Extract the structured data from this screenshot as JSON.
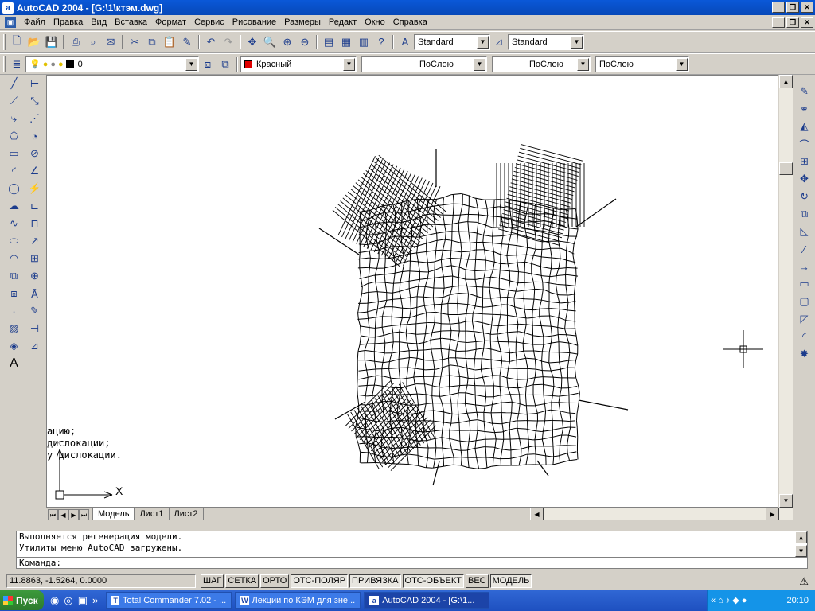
{
  "window": {
    "title": "AutoCAD 2004 - [G:\\1\\ктэм.dwg]",
    "app_icon": "a",
    "minimize": "_",
    "restore": "❐",
    "close": "✕"
  },
  "menu": {
    "items": [
      "Файл",
      "Правка",
      "Вид",
      "Вставка",
      "Формат",
      "Сервис",
      "Рисование",
      "Размеры",
      "Редакт",
      "Окно",
      "Справка"
    ]
  },
  "toolbar1": {
    "text_style": "Standard",
    "dim_style": "Standard"
  },
  "toolbar2": {
    "layer": "0",
    "color": "Красный",
    "color_hex": "#e00000",
    "linetype": "ПоСлою",
    "lineweight": "ПоСлою",
    "plotstyle": "ПоСлою"
  },
  "ucs": {
    "x_label": "X",
    "y_label": "Y"
  },
  "drawing_text": {
    "line1": "ацию;",
    "line2": "дислокации;",
    "line3": "у дислокации."
  },
  "tabs": {
    "items": [
      "Модель",
      "Лист1",
      "Лист2"
    ],
    "active": "Модель"
  },
  "command": {
    "history": [
      "Выполняется регенерация модели.",
      "Утилиты меню AutoCAD загружены."
    ],
    "prompt": "Команда:"
  },
  "status": {
    "coords": "11.8863, -1.5264, 0.0000",
    "buttons": [
      {
        "label": "ШАГ",
        "on": false
      },
      {
        "label": "СЕТКА",
        "on": false
      },
      {
        "label": "ОРТО",
        "on": false
      },
      {
        "label": "ОТС-ПОЛЯР",
        "on": true
      },
      {
        "label": "ПРИВЯЗКА",
        "on": true
      },
      {
        "label": "ОТС-ОБЪЕКТ",
        "on": true
      },
      {
        "label": "ВЕС",
        "on": false
      },
      {
        "label": "МОДЕЛЬ",
        "on": true
      }
    ]
  },
  "taskbar": {
    "start": "Пуск",
    "tasks": [
      {
        "label": "Total Commander 7.02 - ...",
        "active": false
      },
      {
        "label": "Лекции по КЭМ для зне...",
        "active": false
      },
      {
        "label": "AutoCAD 2004 - [G:\\1...",
        "active": true
      }
    ],
    "clock": "20:10"
  }
}
